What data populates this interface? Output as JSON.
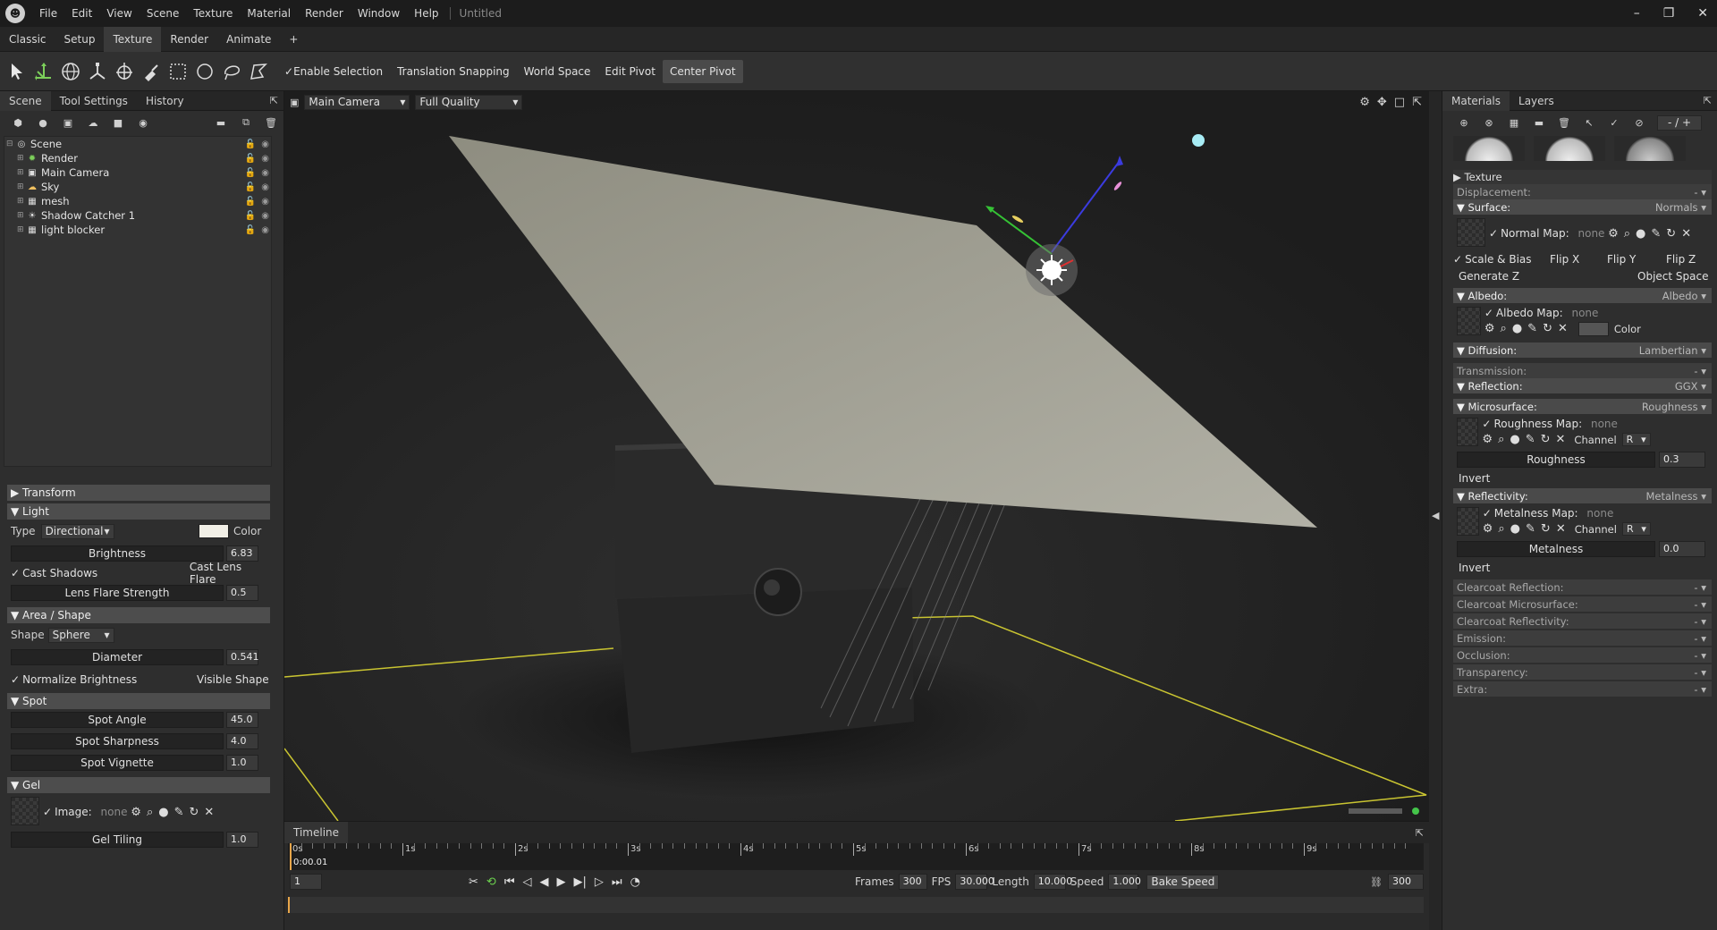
{
  "titlebar": {
    "menu": [
      "File",
      "Edit",
      "View",
      "Scene",
      "Texture",
      "Material",
      "Render",
      "Window",
      "Help"
    ],
    "doc_title": "Untitled",
    "win": {
      "min": "–",
      "max": "❐",
      "close": "✕"
    }
  },
  "workspace_tabs": [
    "Classic",
    "Setup",
    "Texture",
    "Render",
    "Animate",
    "+"
  ],
  "toolbar": {
    "enable_selection": "Enable Selection",
    "translation_snapping": "Translation Snapping",
    "world_space": "World Space",
    "edit_pivot": "Edit Pivot",
    "center_pivot": "Center Pivot"
  },
  "left": {
    "tabs": [
      "Scene",
      "Tool Settings",
      "History"
    ],
    "tree": [
      {
        "label": "Scene",
        "icon": "scene-icon"
      },
      {
        "label": "Render",
        "icon": "gear-icon"
      },
      {
        "label": "Main Camera",
        "icon": "camera-icon"
      },
      {
        "label": "Sky",
        "icon": "sky-icon"
      },
      {
        "label": "mesh",
        "icon": "mesh-icon"
      },
      {
        "label": "Shadow Catcher 1",
        "icon": "light-icon"
      },
      {
        "label": "light blocker",
        "icon": "mesh-icon"
      }
    ],
    "sections": {
      "transform": "Transform",
      "light": "Light",
      "area_shape": "Area / Shape",
      "spot": "Spot",
      "gel": "Gel"
    },
    "light": {
      "type_label": "Type",
      "type_value": "Directional",
      "color_label": "Color",
      "color_swatch": "#f1efe6",
      "brightness_label": "Brightness",
      "brightness": "6.83",
      "cast_shadows": "Cast Shadows",
      "cast_lens_flare": "Cast Lens Flare",
      "lens_flare_label": "Lens Flare Strength",
      "lens_flare": "0.5"
    },
    "shape": {
      "shape_label": "Shape",
      "shape_value": "Sphere",
      "diameter_label": "Diameter",
      "diameter": "0.541",
      "normalize": "Normalize Brightness",
      "visible_shape": "Visible Shape"
    },
    "spot": {
      "angle_label": "Spot Angle",
      "angle": "45.0",
      "sharpness_label": "Spot Sharpness",
      "sharpness": "4.0",
      "vignette_label": "Spot Vignette",
      "vignette": "1.0"
    },
    "gel": {
      "image_label": "Image:",
      "image_value": "none",
      "tiling_label": "Gel Tiling",
      "tiling": "1.0"
    }
  },
  "viewport": {
    "camera": "Main Camera",
    "quality": "Full Quality"
  },
  "timeline": {
    "title": "Timeline",
    "ticks": [
      "0s",
      "1s",
      "2s",
      "3s",
      "4s",
      "5s",
      "6s",
      "7s",
      "8s",
      "9s"
    ],
    "current_time": "0:00.01",
    "frame": "1",
    "frames_label": "Frames",
    "frames": "300",
    "fps_label": "FPS",
    "fps": "30.000",
    "length_label": "Length",
    "length": "10.000",
    "speed_label": "Speed",
    "speed": "1.000",
    "bake_speed": "Bake Speed",
    "end_frame": "300"
  },
  "right": {
    "tabs": [
      "Materials",
      "Layers"
    ],
    "counter": "- / +",
    "texture": "Texture",
    "displacement": "Displacement:",
    "surface": "Surface:",
    "surface_val": "Normals",
    "normal_map": "Normal Map:",
    "none": "none",
    "scale_bias": "Scale & Bias",
    "flip_x": "Flip X",
    "flip_y": "Flip Y",
    "flip_z": "Flip Z",
    "generate_z": "Generate Z",
    "object_space": "Object Space",
    "albedo": "Albedo:",
    "albedo_val": "Albedo",
    "albedo_map": "Albedo Map:",
    "color": "Color",
    "diffusion": "Diffusion:",
    "diffusion_val": "Lambertian",
    "transmission": "Transmission:",
    "reflection": "Reflection:",
    "reflection_val": "GGX",
    "microsurface": "Microsurface:",
    "microsurface_val": "Roughness",
    "roughness_map": "Roughness Map:",
    "channel": "Channel",
    "channel_val": "R",
    "roughness_label": "Roughness",
    "roughness": "0.3",
    "invert": "Invert",
    "reflectivity": "Reflectivity:",
    "reflectivity_val": "Metalness",
    "metalness_map": "Metalness Map:",
    "metalness_label": "Metalness",
    "metalness": "0.0",
    "clearcoat_reflection": "Clearcoat Reflection:",
    "clearcoat_microsurface": "Clearcoat Microsurface:",
    "clearcoat_reflectivity": "Clearcoat Reflectivity:",
    "emission": "Emission:",
    "occlusion": "Occlusion:",
    "transparency": "Transparency:",
    "extra": "Extra:",
    "dash": "- ▾"
  }
}
